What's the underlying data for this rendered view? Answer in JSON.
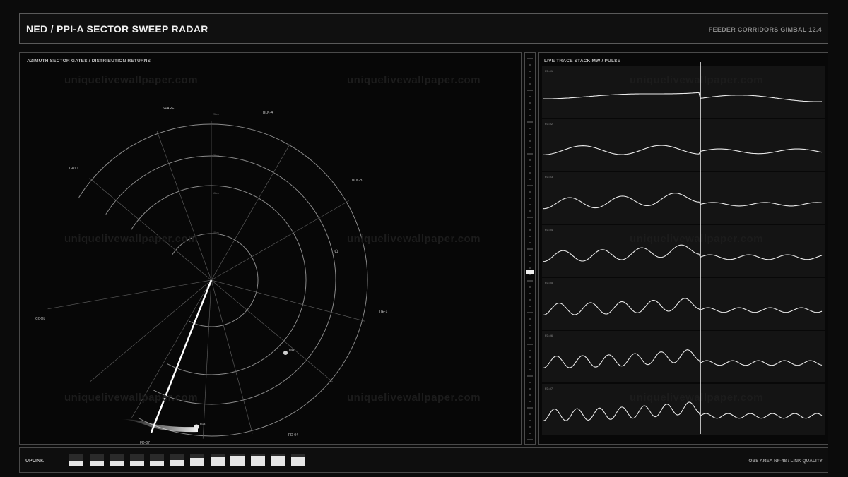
{
  "header": {
    "title": "NED / PPI-A  SECTOR SWEEP RADAR",
    "right": "FEEDER CORRIDORS  GIMBAL 12.4"
  },
  "radar": {
    "panel_label": "AZIMUTH SECTOR GATES  /  DISTRIBUTION RETURNS",
    "sector_labels": [
      "SPARE",
      "BLK-A",
      "BLK-B",
      "GRID",
      "TIE-1",
      "COOL",
      "FD-04",
      "FD-07"
    ],
    "range_labels": [
      "25km",
      "20km",
      "15km",
      "10km"
    ],
    "contacts": [
      "R41",
      "R18"
    ]
  },
  "trace": {
    "panel_label": "LIVE TRACE STACK  MW / PULSE",
    "rows": [
      {
        "label": "FD-01"
      },
      {
        "label": "FD-02"
      },
      {
        "label": "FD-03"
      },
      {
        "label": "FD-04"
      },
      {
        "label": "FD-05"
      },
      {
        "label": "FD-06"
      },
      {
        "label": "FD-07"
      }
    ]
  },
  "footer": {
    "uplink": "UPLINK",
    "right": "OBS AREA NF-48  /  LINK QUALITY",
    "link_quality": [
      0.5,
      0.4,
      0.4,
      0.4,
      0.45,
      0.55,
      0.7,
      0.85,
      0.9,
      0.9,
      0.9,
      0.75
    ]
  },
  "watermark": "uniquelivewallpaper.com",
  "colors": {
    "background": "#0b0b0b",
    "line": "#e6e6e6",
    "grid": "#6a6a6a"
  }
}
